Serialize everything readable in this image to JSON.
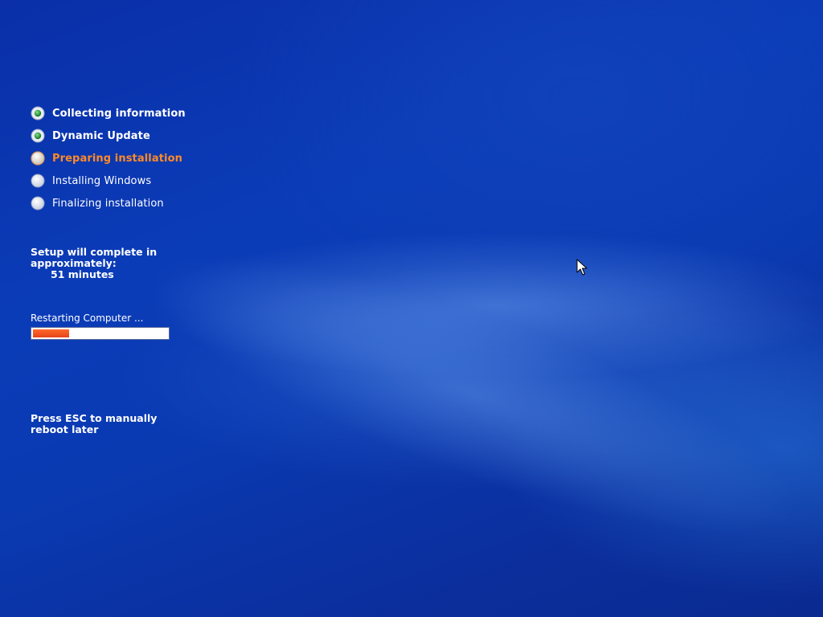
{
  "setup": {
    "steps": [
      {
        "label": "Collecting information",
        "state": "done"
      },
      {
        "label": "Dynamic Update",
        "state": "done"
      },
      {
        "label": "Preparing installation",
        "state": "active"
      },
      {
        "label": "Installing Windows",
        "state": "pending"
      },
      {
        "label": "Finalizing installation",
        "state": "pending"
      }
    ],
    "eta": {
      "line1": "Setup will complete in",
      "line2": "approximately:",
      "time": "51 minutes"
    },
    "status_text": "Restarting Computer ...",
    "progress_fraction": 0.27,
    "hint": {
      "line1": "Press ESC to manually",
      "line2": "reboot later"
    }
  },
  "colors": {
    "active_step": "#ff8a26",
    "done_bullet": "#2e9b3a",
    "progress_fill": "#e6431b",
    "background": "#0b3cb8"
  },
  "icons": {
    "done": "completed-step-icon",
    "active": "current-step-icon",
    "pending": "pending-step-icon",
    "cursor": "mouse-pointer-icon"
  }
}
